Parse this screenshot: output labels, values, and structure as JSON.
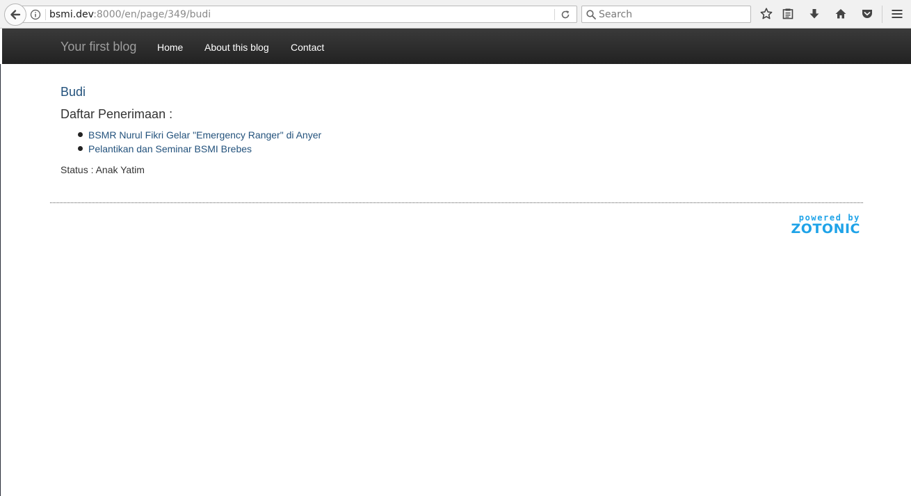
{
  "browser": {
    "url": {
      "host": "bsmi.dev",
      "rest": ":8000/en/page/349/budi"
    },
    "search": {
      "placeholder": "Search"
    }
  },
  "navbar": {
    "brand": "Your first blog",
    "links": [
      {
        "label": "Home"
      },
      {
        "label": "About this blog"
      },
      {
        "label": "Contact"
      }
    ]
  },
  "content": {
    "title": "Budi",
    "section_heading": "Daftar Penerimaan :",
    "items": [
      {
        "label": "BSMR Nurul Fikri Gelar \"Emergency Ranger\" di Anyer"
      },
      {
        "label": "Pelantikan dan Seminar BSMI Brebes"
      }
    ],
    "status": "Status : Anak Yatim"
  },
  "footer": {
    "powered_small": "powered by",
    "powered_big": "ZOTONIC"
  },
  "colors": {
    "link": "#23527c",
    "navbar_bg": "#222222",
    "brand_text": "#9d9d9d",
    "zotonic_blue": "#1fa3e8"
  },
  "icons": {
    "back": "back-arrow-icon",
    "info": "info-icon",
    "reload": "reload-icon",
    "search": "search-icon",
    "bookmark": "star-icon",
    "library": "reading-list-icon",
    "downloads": "download-icon",
    "home": "home-icon",
    "pocket": "pocket-icon",
    "menu": "hamburger-menu-icon"
  }
}
